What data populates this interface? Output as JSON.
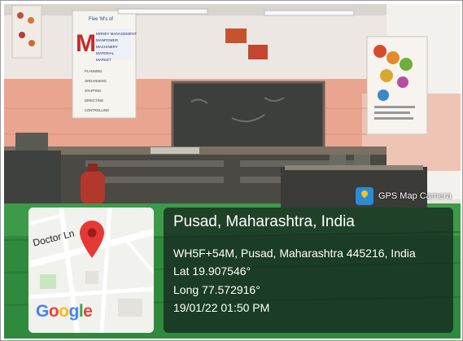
{
  "badge": {
    "icon": "gps-map-camera-icon",
    "label": "GPS Map Camera"
  },
  "map": {
    "street_label": "Doctor Ln",
    "logo_text": "Google",
    "pin_icon": "location-pin-icon"
  },
  "location": {
    "title": "Pusad, Maharashtra, India",
    "address": "WH5F+54M, Pusad, Maharashtra 445216, India",
    "lat": "Lat 19.907546°",
    "long": "Long 77.572916°",
    "datetime": "19/01/22 01:50 PM"
  },
  "posters": {
    "left_heading": "Five 'M's of",
    "left_initial": "M",
    "left_list": [
      "MONEY MANAGEMENT",
      "MANPOWER",
      "MACHINERY",
      "MATERIAL",
      "MARKET"
    ],
    "left_items": [
      "PLANNING",
      "ORGANISING",
      "STAFFING",
      "DIRECTING",
      "CONTROLLING"
    ]
  }
}
